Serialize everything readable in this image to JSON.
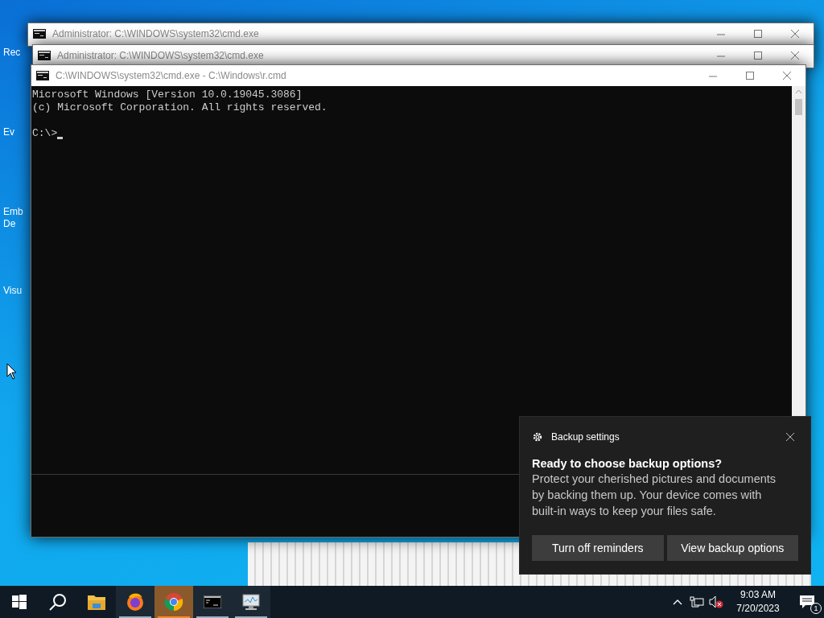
{
  "desktop_icons": [
    {
      "lines": [
        "Rec"
      ]
    },
    {
      "lines": [
        "Ev"
      ]
    },
    {
      "lines": [
        "Emb",
        "De"
      ]
    },
    {
      "lines": [
        "Visu"
      ]
    }
  ],
  "windows": [
    {
      "title": "Administrator: C:\\WINDOWS\\system32\\cmd.exe"
    },
    {
      "title": "Administrator: C:\\WINDOWS\\system32\\cmd.exe"
    },
    {
      "title": "C:\\WINDOWS\\system32\\cmd.exe - C:\\Windows\\r.cmd"
    }
  ],
  "console": {
    "lines": [
      "Microsoft Windows [Version 10.0.19045.3086]",
      "(c) Microsoft Corporation. All rights reserved."
    ],
    "prompt": "C:\\>"
  },
  "toast": {
    "app": "Backup settings",
    "heading": "Ready to choose backup options?",
    "body": "Protect your cherished pictures and documents by backing them up. Your device comes with built-in ways to keep your files safe.",
    "buttons": [
      "Turn off reminders",
      "View backup options"
    ]
  },
  "taskbar": {
    "items": [
      {
        "kind": "start",
        "running": false,
        "selected": false
      },
      {
        "kind": "search",
        "running": false,
        "selected": false
      },
      {
        "kind": "folder",
        "running": false,
        "selected": false
      },
      {
        "kind": "firefox",
        "running": true,
        "selected": false
      },
      {
        "kind": "chrome",
        "running": true,
        "selected": true
      },
      {
        "kind": "terminal",
        "running": true,
        "selected": false
      },
      {
        "kind": "monitor",
        "running": true,
        "selected": false
      }
    ],
    "time": "9:03 AM",
    "date": "7/20/2023",
    "notifications": "1",
    "volume_muted": true
  }
}
